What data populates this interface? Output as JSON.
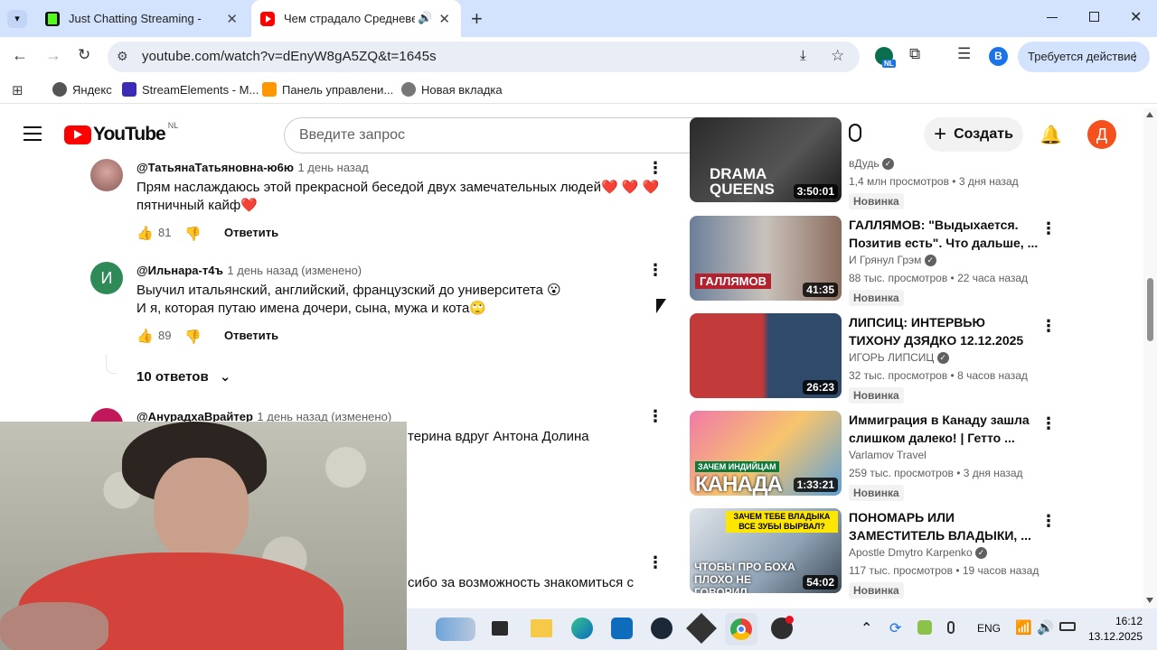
{
  "browser": {
    "tabs": [
      {
        "title": "Just Chatting Streaming - Live S",
        "active": false,
        "favicon_color": "#53fc18"
      },
      {
        "title": "Чем страдало Средневеко",
        "active": true,
        "favicon_color": "#ff0000"
      }
    ],
    "url": "youtube.com/watch?v=dEnyW8gA5ZQ&t=1645s",
    "action_required_label": "Требуется действие",
    "profile_letter": "B",
    "ext_badge": "NL",
    "bookmarks": [
      {
        "label": "Яндекс",
        "icon": "yandex-icon",
        "color": "#555"
      },
      {
        "label": "StreamElements - M...",
        "icon": "streamelements-icon",
        "color": "#3b2bb8"
      },
      {
        "label": "Панель управлени...",
        "icon": "panel-icon",
        "color": "#ff9800"
      },
      {
        "label": "Новая вкладка",
        "icon": "globe-icon",
        "color": "#777"
      }
    ]
  },
  "youtube": {
    "logo_text": "YouTube",
    "region": "NL",
    "search_placeholder": "Введите запрос",
    "create_label": "Создать",
    "avatar_letter": "Д"
  },
  "comments": [
    {
      "user": "@ТатьянаТатьяновна-ю6ю",
      "time": "1 день назад",
      "text1": "Прям наслаждаюсь этой прекрасной беседой двух замечательных людей❤️ ❤️ ❤️",
      "text2": "пятничный кайф❤️",
      "likes": "81",
      "reply": "Ответить"
    },
    {
      "user": "@Ильнара-т4ъ",
      "time": "1 день назад (изменено)",
      "text1": "Выучил итальянский, английский, французский до университета 😮",
      "text2": "И я, которая путаю имена дочери, сына, мужа и кота🙄",
      "likes": "89",
      "reply": "Ответить",
      "avatar_letter": "И",
      "replies_label": "10 ответов"
    },
    {
      "user": "@АнурадхаВрайтер",
      "time": "1 день назад (изменено)",
      "text1": "терина вдруг Антона Долина"
    },
    {
      "text1": "сибо за возможность знакомиться с"
    }
  ],
  "recommendations": [
    {
      "title": "",
      "channel": "вДудь",
      "views": "1,4 млн просмотров",
      "ago": "3 дня назад",
      "badge": "Новинка",
      "duration": "3:50:01",
      "thumb_text": "DRAMA QUEENS"
    },
    {
      "title": "ГАЛЛЯМОВ: \"Выдыхается. Позитив есть\". Что дальше, ...",
      "channel": "И Грянул Грэм",
      "views": "88 тыс. просмотров",
      "ago": "22 часа назад",
      "badge": "Новинка",
      "duration": "41:35",
      "thumb_text": "ГАЛЛЯМОВ"
    },
    {
      "title": "ЛИПСИЦ: ИНТЕРВЬЮ ТИХОНУ ДЗЯДКО 12.12.2025",
      "channel": "ИГОРЬ ЛИПСИЦ",
      "views": "32 тыс. просмотров",
      "ago": "8 часов назад",
      "badge": "Новинка",
      "duration": "26:23",
      "thumb_text": ""
    },
    {
      "title": "Иммиграция в Канаду зашла слишком далеко! | Гетто ...",
      "channel": "Varlamov Travel",
      "views": "259 тыс. просмотров",
      "ago": "3 дня назад",
      "badge": "Новинка",
      "duration": "1:33:21",
      "thumb_text": "КАНАДА",
      "thumb_sub": "ЗАЧЕМ ИНДИЙЦАМ"
    },
    {
      "title": "ПОНОМАРЬ ИЛИ ЗАМЕСТИТЕЛЬ ВЛАДЫКИ, ...",
      "channel": "Apostle Dmytro Karpenko",
      "views": "117 тыс. просмотров",
      "ago": "19 часов назад",
      "badge": "Новинка",
      "duration": "54:02",
      "thumb_text": "ЧТОБЫ ПРО БОХА ПЛОХО НЕ ГОВОРИЛ",
      "thumb_sub": "ЗАЧЕМ ТЕБЕ ВЛАДЫКА ВСЕ ЗУБЫ ВЫРВАЛ?"
    }
  ],
  "taskbar": {
    "lang": "ENG",
    "time": "16:12",
    "date": "13.12.2025"
  }
}
